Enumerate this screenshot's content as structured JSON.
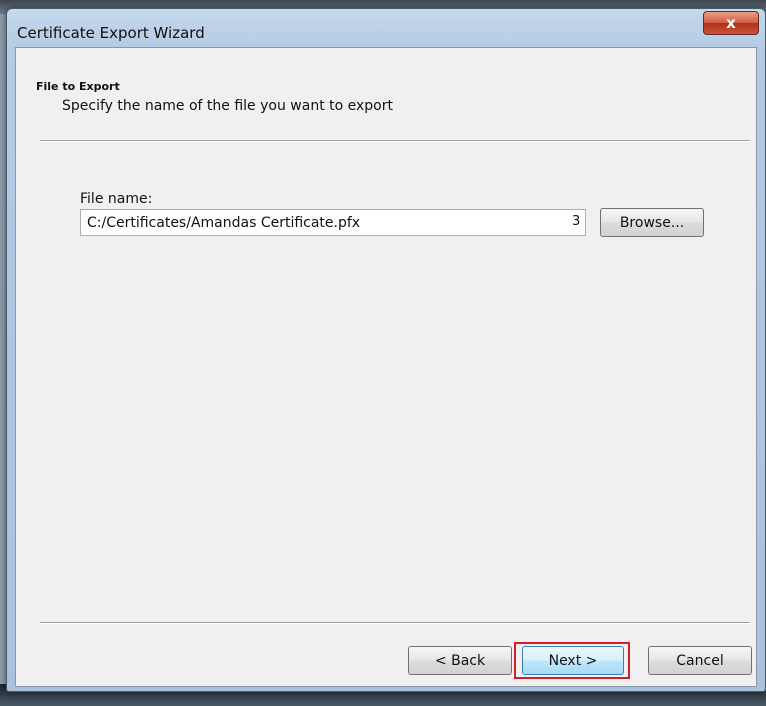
{
  "window": {
    "title": "Certificate Export Wizard",
    "close_label": "x"
  },
  "header": {
    "title": "File to Export",
    "subtitle": "Specify the name of the file you want to export"
  },
  "form": {
    "file_name_label": "File name:",
    "file_name_value": "C:/Certificates/Amandas Certificate.pfx",
    "file_name_tail": "3",
    "browse_label": "Browse..."
  },
  "footer": {
    "back_label": "< Back",
    "next_label": "Next >",
    "cancel_label": "Cancel"
  },
  "colors": {
    "highlight": "#d41f2a",
    "close_button": "#c8533b"
  }
}
